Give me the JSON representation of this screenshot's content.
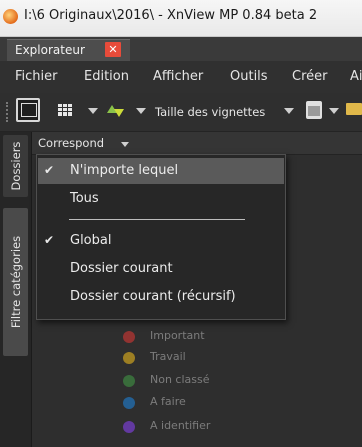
{
  "window": {
    "title": "I:\\6 Originaux\\2016\\ - XnView MP 0.84 beta 2"
  },
  "tabs": [
    {
      "label": "Explorateur",
      "close": "✕"
    }
  ],
  "menu": [
    "Fichier",
    "Edition",
    "Afficher",
    "Outils",
    "Créer",
    "Ai"
  ],
  "toolbar": {
    "thumbnail_size_label": "Taille des vignettes"
  },
  "side_tabs": {
    "folders": "Dossiers",
    "category_filter": "Filtre catégories"
  },
  "filter_bar": {
    "match_label": "Correspond"
  },
  "dropdown": {
    "items": [
      {
        "label": "N'importe lequel",
        "checked": true,
        "highlighted": true
      },
      {
        "label": "Tous",
        "checked": false
      },
      {
        "label": "Global",
        "checked": true
      },
      {
        "label": "Dossier courant",
        "checked": false
      },
      {
        "label": "Dossier courant (récursif)",
        "checked": false
      }
    ]
  },
  "categories": [
    {
      "label": "Important",
      "color": "#e53935"
    },
    {
      "label": "Travail",
      "color": "#f9c21b"
    },
    {
      "label": "Non classé",
      "color": "#43a047"
    },
    {
      "label": "A faire",
      "color": "#1e88e5"
    },
    {
      "label": "A identifier",
      "color": "#8e44ff"
    }
  ],
  "check_glyph": "✔"
}
